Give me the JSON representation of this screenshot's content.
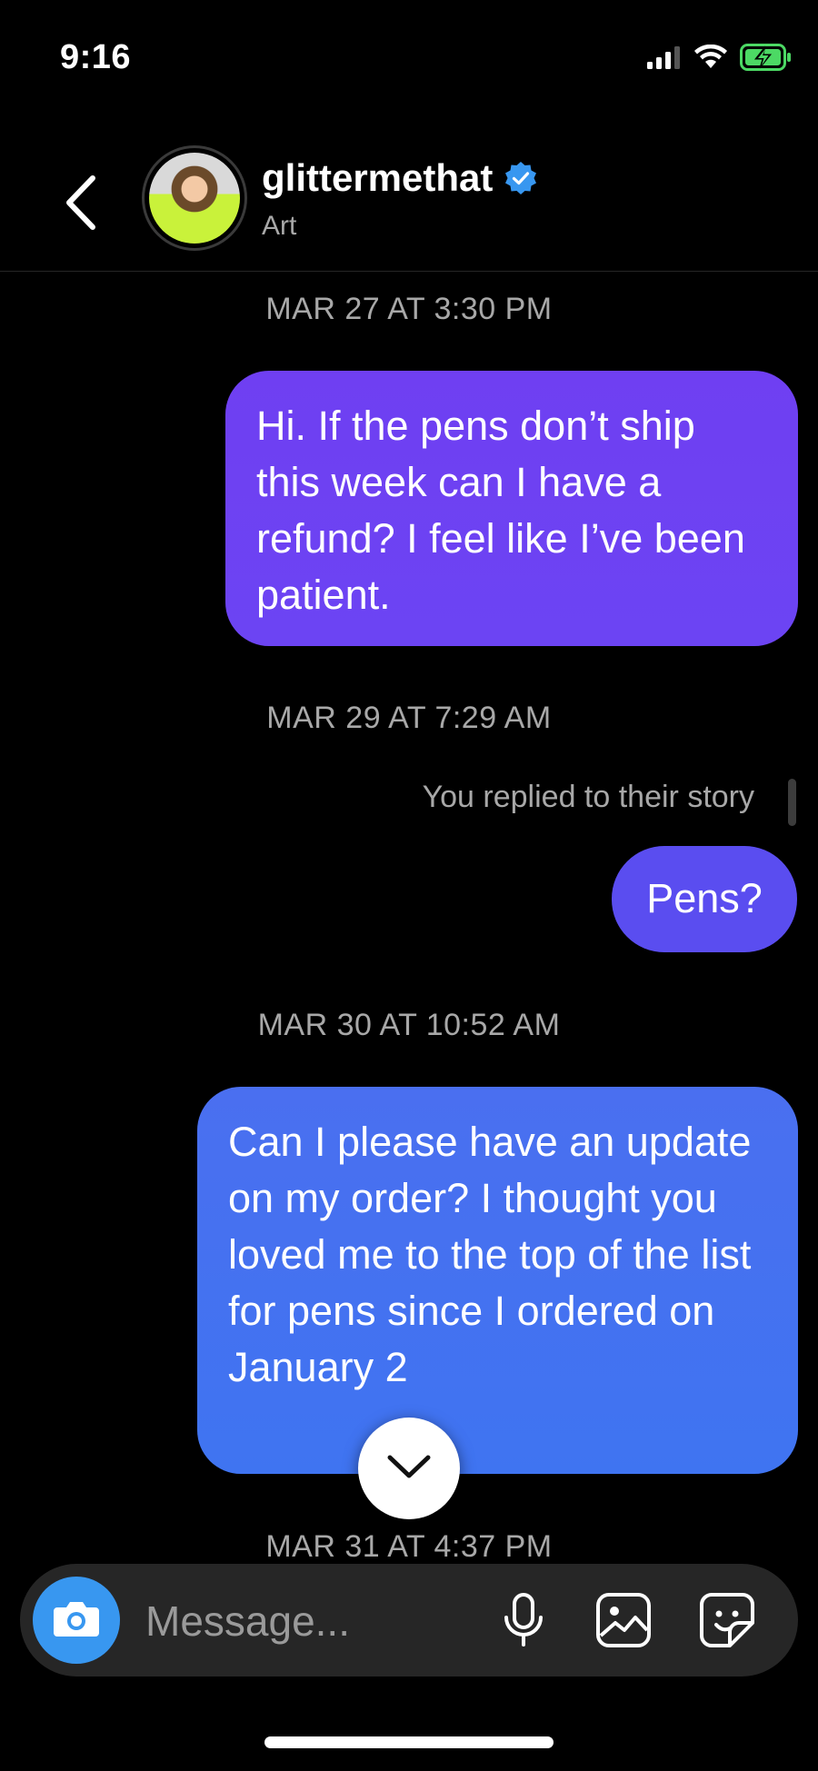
{
  "status_bar": {
    "time": "9:16",
    "icons": [
      "cellular-signal-icon",
      "wifi-icon",
      "battery-charging-icon"
    ]
  },
  "header": {
    "contact_name": "glittermethat",
    "contact_subtitle": "Art",
    "verified": true,
    "icons": [
      "back-chevron-icon",
      "verified-badge-icon"
    ]
  },
  "thread": {
    "messages": [
      {
        "timestamp": "MAR 27 AT 3:30 PM",
        "text": "Hi. If the pens don’t ship this week can I have a refund? I feel like I’ve been patient.",
        "sender": "me"
      },
      {
        "timestamp": "MAR 29 AT 7:29 AM",
        "note": "You replied to their story",
        "text": "Pens?",
        "sender": "me"
      },
      {
        "timestamp": "MAR 30 AT 10:52 AM",
        "text": "Can I please have an update on my order? I thought you loved me to the top of the list for pens since I ordered on January 2",
        "sender": "me"
      }
    ],
    "next_timestamp": "MAR 31 AT 4:37 PM"
  },
  "composer": {
    "placeholder": "Message...",
    "icons": [
      "camera-icon",
      "microphone-icon",
      "gallery-icon",
      "sticker-icon"
    ]
  },
  "colors": {
    "background": "#000000",
    "bubble_purple": "#6c44f3",
    "bubble_indigo": "#5a4df0",
    "bubble_blue": "#4272f1",
    "camera_blue": "#3897f0",
    "verified_blue": "#3897f0",
    "battery_green": "#4cd964"
  }
}
